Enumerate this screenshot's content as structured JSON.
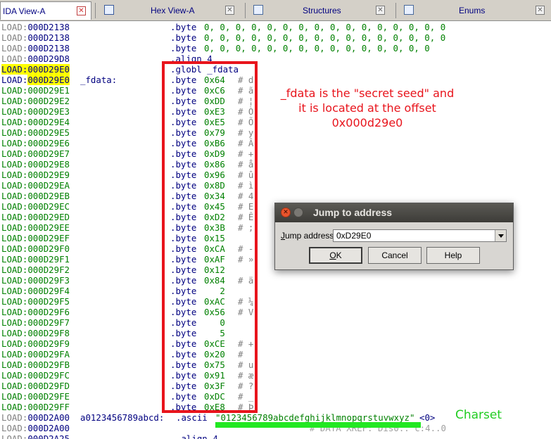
{
  "tabs": [
    {
      "label": "IDA View-A",
      "icon": "none"
    },
    {
      "label": "Hex View-A",
      "icon": "hex-view-icon"
    },
    {
      "label": "Structures",
      "icon": "structures-icon"
    },
    {
      "label": "Enums",
      "icon": "enums-icon"
    }
  ],
  "listing": {
    "rows": [
      {
        "seg": "LOAD:",
        "off": "000D2138",
        "label": "",
        "mnem": ".byte",
        "ops": "0, 0, 0, 0, 0, 0, 0, 0, 0, 0, 0, 0, 0, 0, 0, 0",
        "cmt": ""
      },
      {
        "seg": "LOAD:",
        "off": "000D2138",
        "label": "",
        "mnem": ".byte",
        "ops": "0, 0, 0, 0, 0, 0, 0, 0, 0, 0, 0, 0, 0, 0, 0, 0",
        "cmt": ""
      },
      {
        "seg": "LOAD:",
        "off": "000D2138",
        "label": "",
        "mnem": ".byte",
        "ops": "0, 0, 0, 0, 0, 0, 0, 0, 0, 0, 0, 0, 0, 0, 0",
        "cmt": ""
      },
      {
        "seg": "LOAD:",
        "off": "000D29D8",
        "label": "",
        "mnem": ".align 4",
        "ops": "",
        "cmt": ""
      },
      {
        "seg": "LOAD:",
        "off": "000D29E0",
        "label": "",
        "mnem": ".globl _fdata",
        "ops": "",
        "cmt": ""
      },
      {
        "seg": "LOAD:",
        "off": "000D29E0",
        "label": "_fdata:",
        "mnem": ".byte",
        "ops": "0x64",
        "cmt": "# d"
      },
      {
        "seg": "LOAD:",
        "off": "000D29E1",
        "label": "",
        "mnem": ".byte",
        "ops": "0xC6",
        "cmt": "# ã"
      },
      {
        "seg": "LOAD:",
        "off": "000D29E2",
        "label": "",
        "mnem": ".byte",
        "ops": "0xDD",
        "cmt": "# ¦"
      },
      {
        "seg": "LOAD:",
        "off": "000D29E3",
        "label": "",
        "mnem": ".byte",
        "ops": "0xE3",
        "cmt": "# Ò"
      },
      {
        "seg": "LOAD:",
        "off": "000D29E4",
        "label": "",
        "mnem": ".byte",
        "ops": "0xE5",
        "cmt": "# Õ"
      },
      {
        "seg": "LOAD:",
        "off": "000D29E5",
        "label": "",
        "mnem": ".byte",
        "ops": "0x79",
        "cmt": "# y"
      },
      {
        "seg": "LOAD:",
        "off": "000D29E6",
        "label": "",
        "mnem": ".byte",
        "ops": "0xB6",
        "cmt": "# Â"
      },
      {
        "seg": "LOAD:",
        "off": "000D29E7",
        "label": "",
        "mnem": ".byte",
        "ops": "0xD9",
        "cmt": "# +"
      },
      {
        "seg": "LOAD:",
        "off": "000D29E8",
        "label": "",
        "mnem": ".byte",
        "ops": "0x86",
        "cmt": "# å"
      },
      {
        "seg": "LOAD:",
        "off": "000D29E9",
        "label": "",
        "mnem": ".byte",
        "ops": "0x96",
        "cmt": "# û"
      },
      {
        "seg": "LOAD:",
        "off": "000D29EA",
        "label": "",
        "mnem": ".byte",
        "ops": "0x8D",
        "cmt": "# ì"
      },
      {
        "seg": "LOAD:",
        "off": "000D29EB",
        "label": "",
        "mnem": ".byte",
        "ops": "0x34",
        "cmt": "# 4"
      },
      {
        "seg": "LOAD:",
        "off": "000D29EC",
        "label": "",
        "mnem": ".byte",
        "ops": "0x45",
        "cmt": "# E"
      },
      {
        "seg": "LOAD:",
        "off": "000D29ED",
        "label": "",
        "mnem": ".byte",
        "ops": "0xD2",
        "cmt": "# Ê"
      },
      {
        "seg": "LOAD:",
        "off": "000D29EE",
        "label": "",
        "mnem": ".byte",
        "ops": "0x3B",
        "cmt": "# ;"
      },
      {
        "seg": "LOAD:",
        "off": "000D29EF",
        "label": "",
        "mnem": ".byte",
        "ops": "0x15",
        "cmt": ""
      },
      {
        "seg": "LOAD:",
        "off": "000D29F0",
        "label": "",
        "mnem": ".byte",
        "ops": "0xCA",
        "cmt": "# -"
      },
      {
        "seg": "LOAD:",
        "off": "000D29F1",
        "label": "",
        "mnem": ".byte",
        "ops": "0xAF",
        "cmt": "# »"
      },
      {
        "seg": "LOAD:",
        "off": "000D29F2",
        "label": "",
        "mnem": ".byte",
        "ops": "0x12",
        "cmt": ""
      },
      {
        "seg": "LOAD:",
        "off": "000D29F3",
        "label": "",
        "mnem": ".byte",
        "ops": "0x84",
        "cmt": "# ä"
      },
      {
        "seg": "LOAD:",
        "off": "000D29F4",
        "label": "",
        "mnem": ".byte",
        "ops": "   2",
        "cmt": ""
      },
      {
        "seg": "LOAD:",
        "off": "000D29F5",
        "label": "",
        "mnem": ".byte",
        "ops": "0xAC",
        "cmt": "# ¼"
      },
      {
        "seg": "LOAD:",
        "off": "000D29F6",
        "label": "",
        "mnem": ".byte",
        "ops": "0x56",
        "cmt": "# V"
      },
      {
        "seg": "LOAD:",
        "off": "000D29F7",
        "label": "",
        "mnem": ".byte",
        "ops": "   0",
        "cmt": ""
      },
      {
        "seg": "LOAD:",
        "off": "000D29F8",
        "label": "",
        "mnem": ".byte",
        "ops": "   5",
        "cmt": ""
      },
      {
        "seg": "LOAD:",
        "off": "000D29F9",
        "label": "",
        "mnem": ".byte",
        "ops": "0xCE",
        "cmt": "# +"
      },
      {
        "seg": "LOAD:",
        "off": "000D29FA",
        "label": "",
        "mnem": ".byte",
        "ops": "0x20",
        "cmt": "#"
      },
      {
        "seg": "LOAD:",
        "off": "000D29FB",
        "label": "",
        "mnem": ".byte",
        "ops": "0x75",
        "cmt": "# u"
      },
      {
        "seg": "LOAD:",
        "off": "000D29FC",
        "label": "",
        "mnem": ".byte",
        "ops": "0x91",
        "cmt": "# æ"
      },
      {
        "seg": "LOAD:",
        "off": "000D29FD",
        "label": "",
        "mnem": ".byte",
        "ops": "0x3F",
        "cmt": "# ?"
      },
      {
        "seg": "LOAD:",
        "off": "000D29FE",
        "label": "",
        "mnem": ".byte",
        "ops": "0xDC",
        "cmt": "# _"
      },
      {
        "seg": "LOAD:",
        "off": "000D29FF",
        "label": "",
        "mnem": ".byte",
        "ops": "0xE8",
        "cmt": "# Þ"
      }
    ],
    "ascii_row": {
      "seg": "LOAD:",
      "off": "000D2A00",
      "label": "a0123456789abcd:",
      "mnem": ".ascii",
      "string": "\"0123456789abcdefghijklmnopqrstuvwxyz\"",
      "suffix": "<0>"
    },
    "tail_rows": [
      {
        "seg": "LOAD:",
        "off": "000D2A00",
        "text": "# DATA XREF: Dis0.. c:4..0"
      },
      {
        "seg": "LOAD:",
        "off": "000D2A25",
        "text": ".align 4"
      }
    ]
  },
  "annotation": {
    "lines": [
      "_fdata is the \"secret seed\" and",
      "it is located at the offset",
      "0x000d29e0"
    ],
    "charset_label": "Charset",
    "color": "#e8141c",
    "charset_color": "#22cc22"
  },
  "dialog": {
    "title": "Jump to address",
    "field_label": "Jump address",
    "field_value": "0xD29E0",
    "ok_label": "OK",
    "cancel_label": "Cancel",
    "help_label": "Help"
  }
}
